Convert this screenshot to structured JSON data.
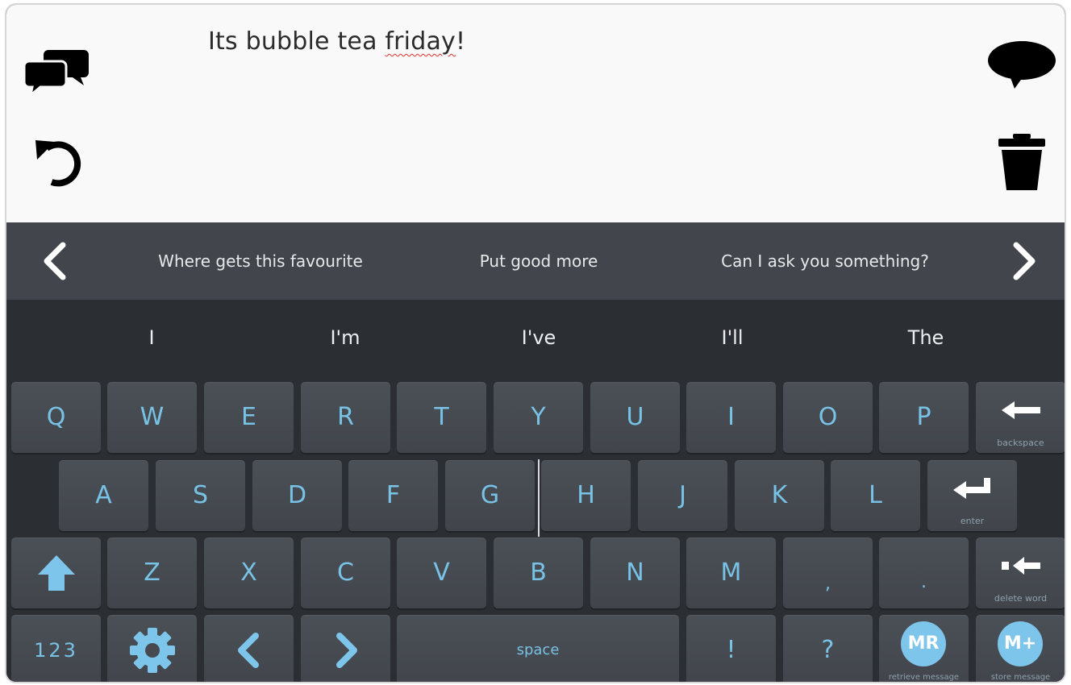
{
  "message": {
    "text_before": "Its bubble tea ",
    "misspelled_word": "friday",
    "text_after": "!"
  },
  "icons": {
    "conversations": "chat-bubbles-icon",
    "undo": "undo-icon",
    "speak": "speech-bubble-icon",
    "clear": "trash-icon"
  },
  "phrases": [
    "Where gets this favourite",
    "Put good more",
    "Can I ask you something?"
  ],
  "predictions": [
    "I",
    "I'm",
    "I've",
    "I'll",
    "The"
  ],
  "keyboard": {
    "row1": [
      "Q",
      "W",
      "E",
      "R",
      "T",
      "Y",
      "U",
      "I",
      "O",
      "P"
    ],
    "row2": [
      "A",
      "S",
      "D",
      "F",
      "G",
      "H",
      "J",
      "K",
      "L"
    ],
    "row3": [
      "Z",
      "X",
      "C",
      "V",
      "B",
      "N",
      "M",
      ",",
      "."
    ],
    "backspace_label": "backspace",
    "enter_label": "enter",
    "delete_word_label": "delete word",
    "numbers_label": "123",
    "space_label": "space",
    "exclamation": "!",
    "question": "?",
    "retrieve": {
      "badge": "MR",
      "label": "retrieve message"
    },
    "store": {
      "badge": "M+",
      "label": "store message"
    }
  },
  "colors": {
    "key_text": "#78c2e6",
    "accent": "#7dc5ea",
    "key_bg": "#464a50",
    "keyboard_bg": "#2b2e33"
  }
}
